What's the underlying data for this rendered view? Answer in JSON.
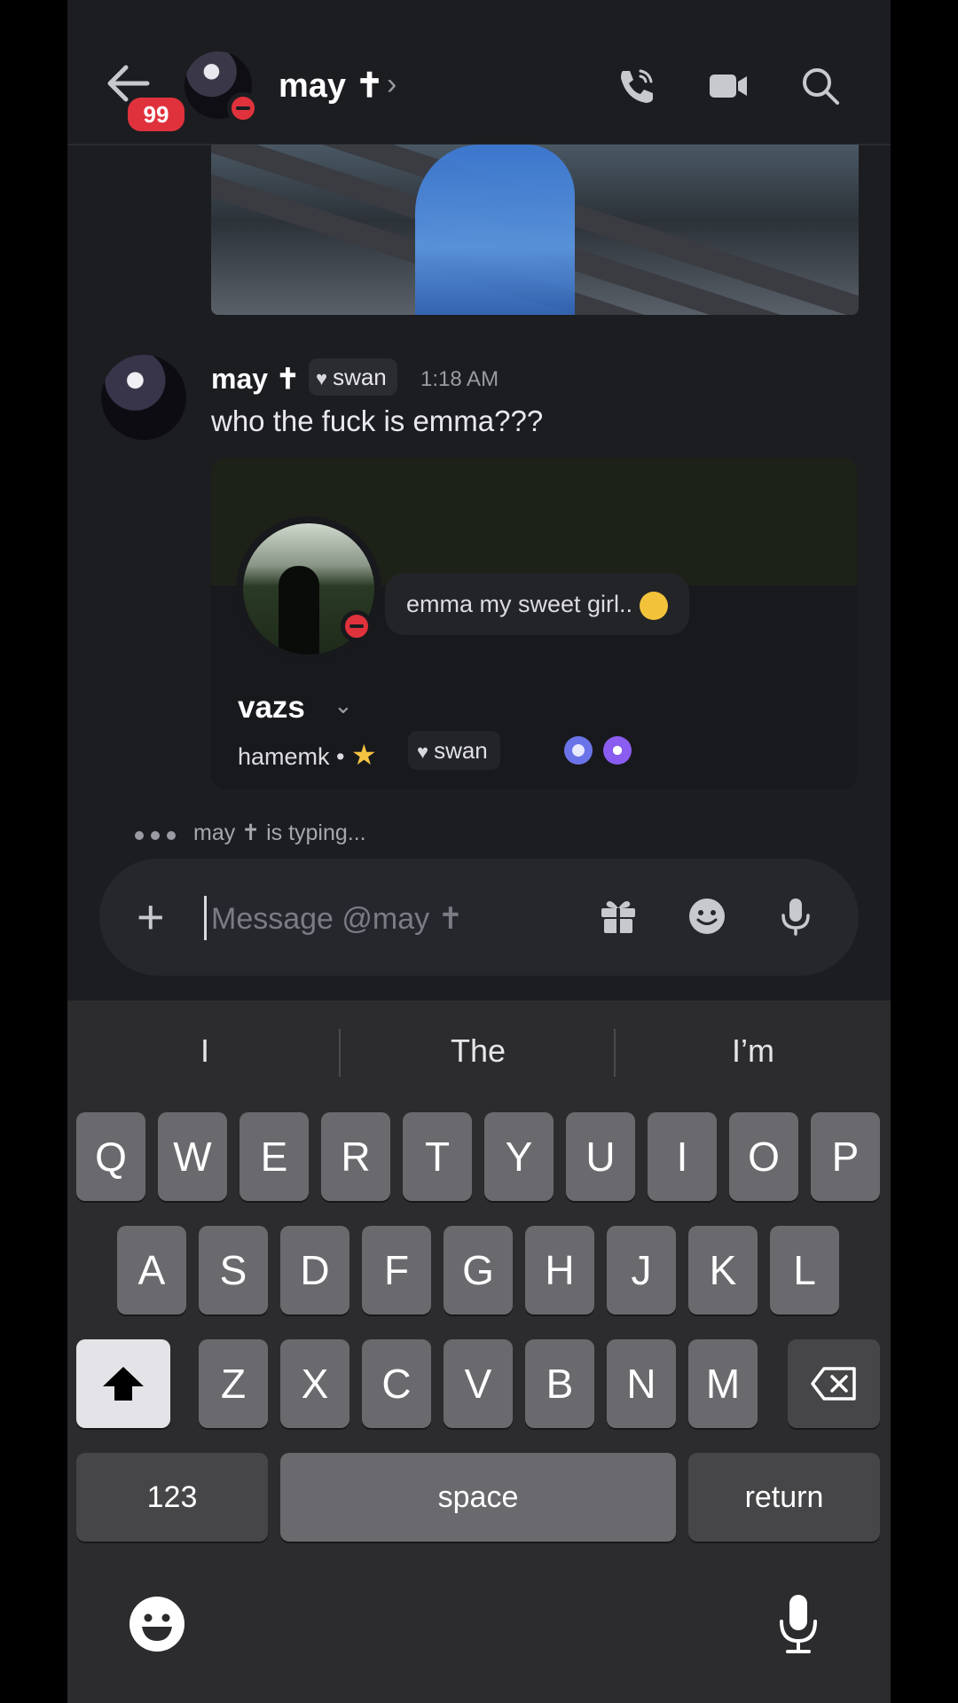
{
  "header": {
    "unread_badge": "99",
    "contact_name": "may ✝",
    "chevron": "›",
    "icons": [
      "back-arrow-icon",
      "phone-icon",
      "video-icon",
      "search-icon"
    ]
  },
  "message": {
    "author": "may ✝",
    "clan_tag": "swan",
    "time": "1:18 AM",
    "text": "who the fuck is emma???"
  },
  "profile_card": {
    "status_text": "emma my sweet girl..",
    "display_name": "vazs",
    "username": "hamemk",
    "separator": "•",
    "clan_tag": "swan"
  },
  "typing_indicator": "may ✝ is typing...",
  "composer": {
    "placeholder": "Message @may ✝",
    "plus": "+"
  },
  "keyboard": {
    "suggestions": [
      "I",
      "The",
      "I’m"
    ],
    "row1": [
      "Q",
      "W",
      "E",
      "R",
      "T",
      "Y",
      "U",
      "I",
      "O",
      "P"
    ],
    "row2": [
      "A",
      "S",
      "D",
      "F",
      "G",
      "H",
      "J",
      "K",
      "L"
    ],
    "row3": [
      "Z",
      "X",
      "C",
      "V",
      "B",
      "N",
      "M"
    ],
    "numbers_key": "123",
    "space_key": "space",
    "return_key": "return"
  },
  "colors": {
    "background": "#1c1d21",
    "dnd_red": "#e0323c",
    "keyboard_bg": "#2c2c2e"
  }
}
